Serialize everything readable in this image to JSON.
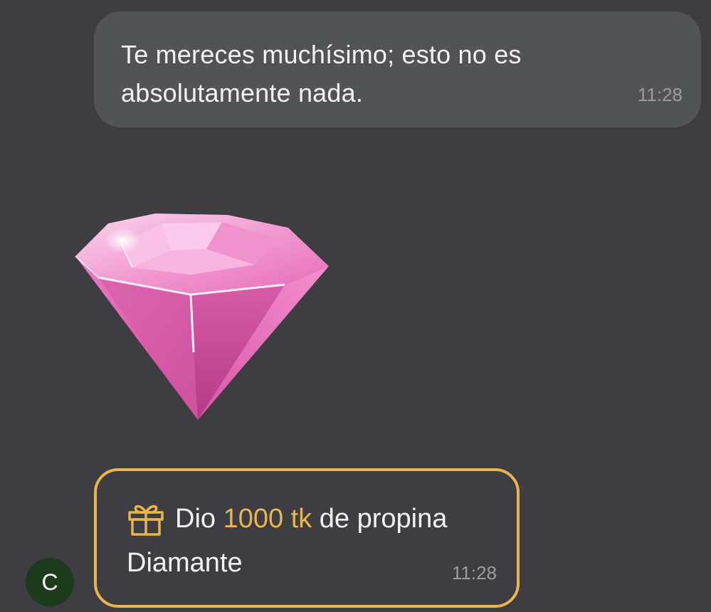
{
  "messages": {
    "text_message": {
      "lines": [
        "Te mereces muchísimo; esto no es",
        "absolutamente nada."
      ],
      "time": "11:28"
    },
    "sticker": {
      "icon": "diamond-sticker",
      "color": "#e86bb5"
    },
    "tip_message": {
      "prefix": "Dio ",
      "amount": "1000 tk",
      "suffix": " de propina",
      "gift_name": "Diamante",
      "time": "11:28",
      "icon": "gift-icon",
      "accent_color": "#e8b64c"
    }
  },
  "avatar": {
    "initial": "C"
  }
}
